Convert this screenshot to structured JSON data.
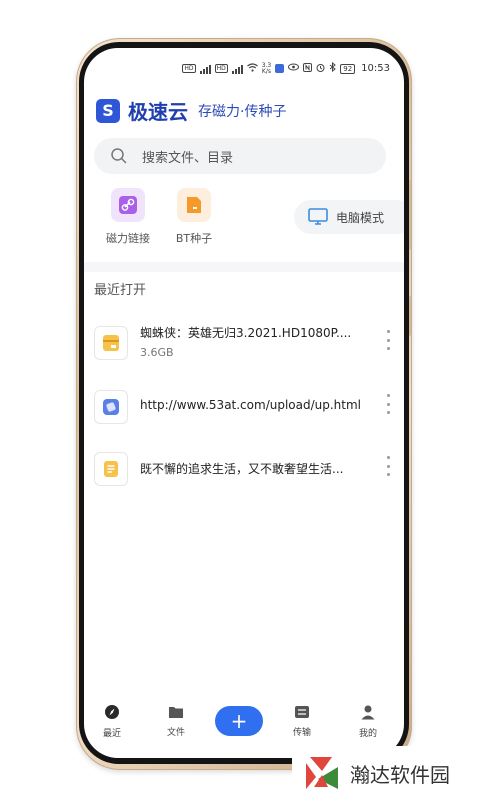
{
  "status_bar": {
    "net_speed": "3.3",
    "net_unit": "K/s",
    "battery": "92",
    "time": "10:53"
  },
  "header": {
    "logo_letter": "S",
    "app_name": "极速云",
    "slogan": "存磁力·传种子"
  },
  "search": {
    "placeholder": "搜索文件、目录"
  },
  "tools": [
    {
      "label": "磁力链接",
      "icon": "link-icon",
      "color": "#a860e8"
    },
    {
      "label": "BT种子",
      "icon": "bt-file-icon",
      "color": "#f59a2a"
    }
  ],
  "pc_mode": {
    "label": "电脑模式",
    "icon": "monitor-icon"
  },
  "recent": {
    "title": "最近打开",
    "items": [
      {
        "name": "蜘蛛侠：英雄无归3.2021.HD1080P....",
        "size": "3.6GB",
        "icon": "bt-archive-icon"
      },
      {
        "name": "http://www.53at.com/upload/up.html",
        "size": "",
        "icon": "link-file-icon"
      },
      {
        "name": "既不懈的追求生活，又不敢奢望生活...",
        "size": "",
        "icon": "document-icon"
      }
    ]
  },
  "bottom_nav": {
    "recent": "最近",
    "files": "文件",
    "add": "+",
    "transfer": "传输",
    "mine": "我的"
  },
  "watermark": {
    "text": "瀚达软件园"
  },
  "colors": {
    "brand_blue": "#2f56d6",
    "add_button": "#2f6ff0",
    "frame_gold": "#d9bf9c"
  }
}
